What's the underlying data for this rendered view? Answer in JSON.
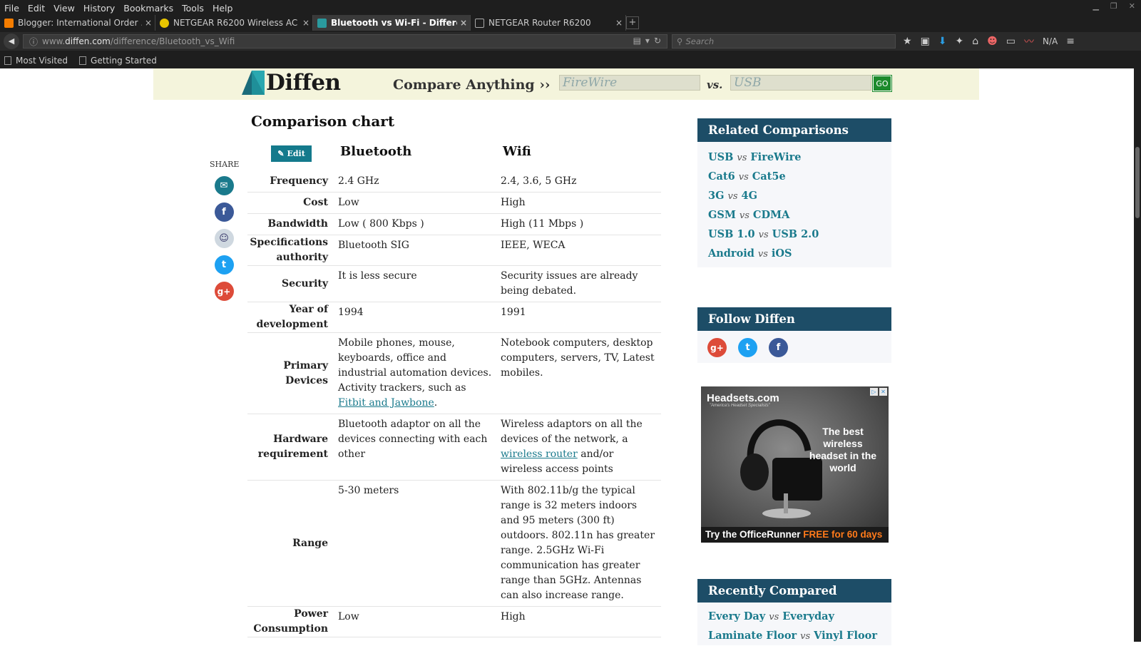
{
  "browser": {
    "menu": [
      "File",
      "Edit",
      "View",
      "History",
      "Bookmarks",
      "Tools",
      "Help"
    ],
    "tabs": [
      {
        "title": "Blogger: International Order ...",
        "icon": "blogger-icon",
        "active": false
      },
      {
        "title": "NETGEAR R6200 Wireless AC ...",
        "icon": "netgear-icon",
        "active": false
      },
      {
        "title": "Bluetooth vs Wi-Fi - Differe...",
        "icon": "diffen-icon",
        "active": true
      },
      {
        "title": "NETGEAR Router R6200",
        "icon": "page-icon",
        "active": false
      }
    ],
    "new_tab": "+",
    "url_prefix": "www.",
    "url_domain": "diffen.com",
    "url_path": "/difference/Bluetooth_vs_Wifi",
    "search_placeholder": "Search",
    "na_label": "N/A",
    "bookmarks": [
      "Most Visited",
      "Getting Started"
    ]
  },
  "site": {
    "logo_text": "Diffen",
    "compare_label": "Compare Anything ››",
    "input1_placeholder": "FireWire",
    "vs_label": "vs.",
    "input2_placeholder": "USB",
    "go_label": "GO"
  },
  "chart": {
    "title": "Comparison chart",
    "edit_label": "Edit",
    "col1": "Bluetooth",
    "col2": "Wifi",
    "rows": [
      {
        "label": "Frequency",
        "c1": "2.4 GHz",
        "c2": "2.4, 3.6, 5 GHz"
      },
      {
        "label": "Cost",
        "c1": "Low",
        "c2": "High"
      },
      {
        "label": "Bandwidth",
        "c1": "Low ( 800 Kbps )",
        "c2": "High (11 Mbps )"
      },
      {
        "label": "Specifications authority",
        "c1": "Bluetooth SIG",
        "c2": "IEEE, WECA"
      },
      {
        "label": "Security",
        "c1": "It is less secure",
        "c2": "Security issues are already being debated."
      },
      {
        "label": "Year of development",
        "c1": "1994",
        "c2": "1991"
      },
      {
        "label": "Primary Devices",
        "c1_pre": "Mobile phones, mouse, keyboards, office and industrial automation devices. Activity trackers, such as ",
        "c1_link": "Fitbit and Jawbone",
        "c1_post": ".",
        "c2": "Notebook computers, desktop computers, servers, TV, Latest mobiles."
      },
      {
        "label": "Hardware requirement",
        "c1": "Bluetooth adaptor on all the devices connecting with each other",
        "c2_pre": "Wireless adaptors on all the devices of the network, a ",
        "c2_link": "wireless router",
        "c2_post": " and/or wireless access points"
      },
      {
        "label": "Range",
        "c1": "5-30 meters",
        "c2": "With 802.11b/g the typical range is 32 meters indoors and 95 meters (300 ft) outdoors. 802.11n has greater range. 2.5GHz Wi-Fi communication has greater range than 5GHz. Antennas can also increase range."
      },
      {
        "label": "Power Consumption",
        "c1": "Low",
        "c2": "High"
      }
    ]
  },
  "share": {
    "label": "SHARE",
    "icons": [
      {
        "name": "email-icon",
        "color": "#1a7a8c",
        "glyph": "✉"
      },
      {
        "name": "facebook-icon",
        "color": "#3b5998",
        "glyph": "f"
      },
      {
        "name": "reddit-icon",
        "color": "#cfd8e0",
        "glyph": "☺"
      },
      {
        "name": "twitter-icon",
        "color": "#1da1f2",
        "glyph": "🐦"
      },
      {
        "name": "google-plus-icon",
        "color": "#dd4b39",
        "glyph": "g+"
      }
    ]
  },
  "sidebar": {
    "related_title": "Related Comparisons",
    "related": [
      {
        "a": "USB",
        "b": "FireWire"
      },
      {
        "a": "Cat6",
        "b": "Cat5e"
      },
      {
        "a": "3G",
        "b": "4G"
      },
      {
        "a": "GSM",
        "b": "CDMA"
      },
      {
        "a": "USB 1.0",
        "b": "USB 2.0"
      },
      {
        "a": "Android",
        "b": "iOS"
      }
    ],
    "vs": "vs",
    "follow_title": "Follow Diffen",
    "recent_title": "Recently Compared",
    "recent": [
      {
        "a": "Every Day",
        "b": "Everyday"
      },
      {
        "a": "Laminate Floor",
        "b": "Vinyl Floor"
      }
    ]
  },
  "ad": {
    "brand": "Headsets.com",
    "tagline": "\"America's Headset Specialists\"",
    "headline": "The best wireless headset in the world",
    "cta_pre": "Try the OfficeRunner ",
    "cta_highlight": "FREE for 60 days"
  },
  "colors": {
    "accent": "#1a7a8c",
    "sidebar_header": "#1d4d67",
    "band": "#f4f4dc",
    "go": "#1c8a2c"
  }
}
